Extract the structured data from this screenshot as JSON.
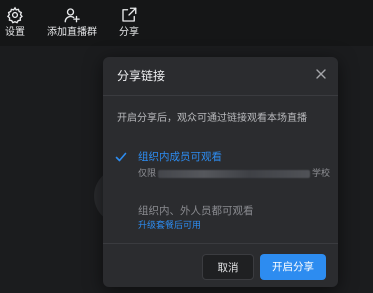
{
  "toolbar": {
    "items": [
      {
        "label": "设置",
        "icon": "gear-icon"
      },
      {
        "label": "添加直播群",
        "icon": "add-user-icon"
      },
      {
        "label": "分享",
        "icon": "share-icon"
      }
    ]
  },
  "dialog": {
    "title": "分享链接",
    "description": "开启分享后，观众可通过链接观看本场直播",
    "options": [
      {
        "title": "组织内成员可观看",
        "subtitle_prefix": "仅限",
        "subtitle_suffix": "学校",
        "selected": true
      },
      {
        "title": "组织内、外人员都可观看",
        "subtitle": "升级套餐后可用",
        "selected": false
      }
    ],
    "cancel_label": "取消",
    "confirm_label": "开启分享"
  },
  "colors": {
    "accent": "#2d8cf0",
    "background": "#1b1c1e",
    "dialog_bg": "#2b2c2f"
  }
}
